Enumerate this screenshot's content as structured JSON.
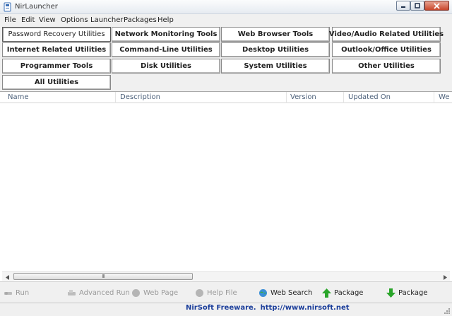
{
  "window": {
    "title": "NirLauncher"
  },
  "menu": [
    "File",
    "Edit",
    "View",
    "Options",
    "Launcher",
    "Packages",
    "Help"
  ],
  "categories": [
    "Password Recovery Utilities",
    "Network Monitoring Tools",
    "Web Browser Tools",
    "Video/Audio Related Utilities",
    "Internet Related Utilities",
    "Command-Line Utilities",
    "Desktop Utilities",
    "Outlook/Office Utilities",
    "Programmer Tools",
    "Disk Utilities",
    "System Utilities",
    "Other Utilities",
    "All Utilities"
  ],
  "active_category": "Password Recovery Utilities",
  "columns": [
    "Name",
    "Description",
    "Version",
    "Updated On",
    "We"
  ],
  "scrollbar": {
    "thumb_glyph": "III"
  },
  "toolbar": {
    "run": "Run",
    "advanced_run": "Advanced Run",
    "web_page": "Web Page",
    "help_file": "Help File",
    "web_search": "Web Search",
    "package_up": "Package",
    "package_down": "Package"
  },
  "status": {
    "label": "NirSoft Freeware.",
    "url": "http://www.nirsoft.net"
  },
  "colors": {
    "status_text": "#1a3d9a",
    "package_up_icon": "#2aa52a",
    "package_down_icon": "#2aa52a",
    "close_button": "#c9462b"
  }
}
